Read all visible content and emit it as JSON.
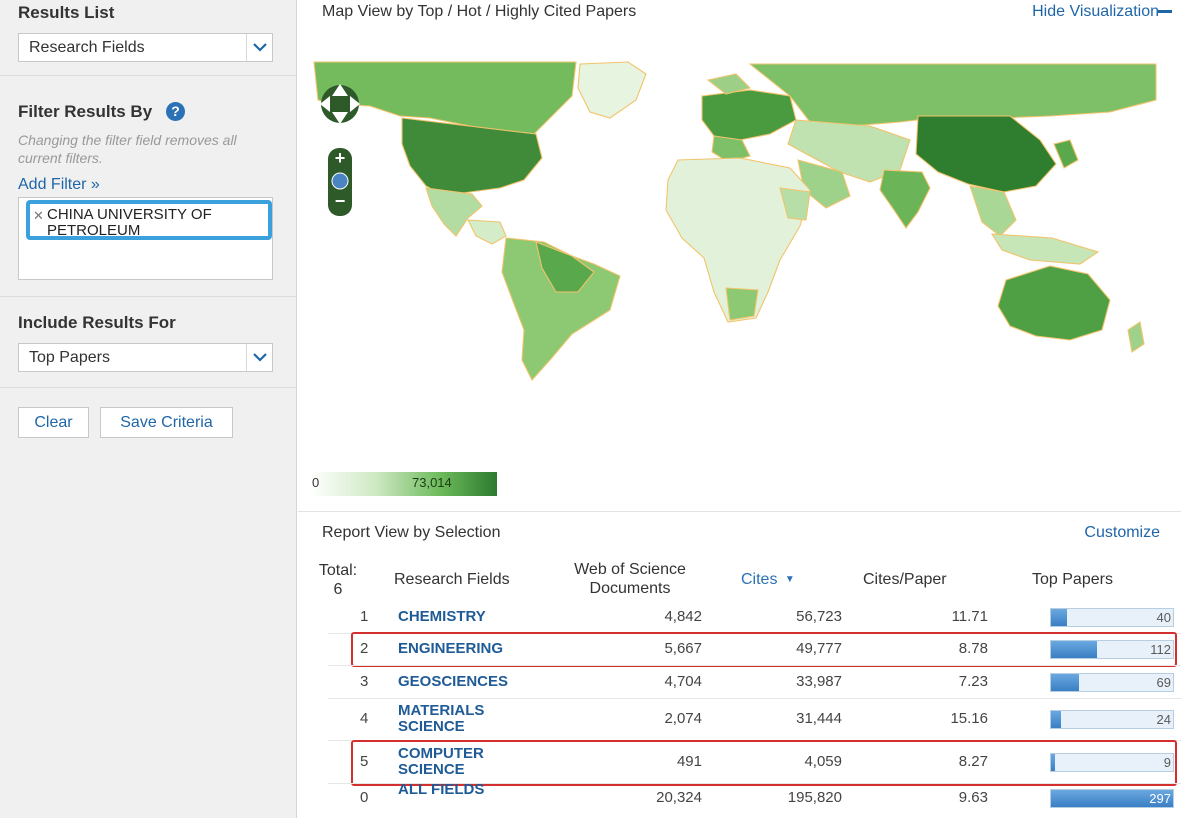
{
  "sidebar": {
    "results_list_title": "Results List",
    "results_list_value": "Research Fields",
    "filter_title": "Filter Results By",
    "help_glyph": "?",
    "filter_hint": "Changing the filter field removes all current filters.",
    "add_filter": "Add Filter »",
    "filter_chip": "CHINA UNIVERSITY OF PETROLEUM",
    "include_title": "Include Results For",
    "include_value": "Top Papers",
    "clear_button": "Clear",
    "save_button": "Save Criteria"
  },
  "map_view": {
    "title": "Map View by Top / Hot / Highly Cited Papers",
    "hide_label": "Hide Visualization",
    "legend_min": "0",
    "legend_max": "73,014"
  },
  "report_view": {
    "title": "Report View by Selection",
    "customize": "Customize",
    "headers": {
      "total_label": "Total:",
      "total_value": "6",
      "field": "Research Fields",
      "docs": "Web of Science Documents",
      "cites": "Cites",
      "cites_per_paper": "Cites/Paper",
      "top_papers": "Top Papers"
    },
    "rows": [
      {
        "rank": "1",
        "field": "CHEMISTRY",
        "docs": "4,842",
        "cites": "56,723",
        "cpp": "11.71",
        "top": "40",
        "top_fraction": 0.1347,
        "highlight": false
      },
      {
        "rank": "2",
        "field": "ENGINEERING",
        "docs": "5,667",
        "cites": "49,777",
        "cpp": "8.78",
        "top": "112",
        "top_fraction": 0.3771,
        "highlight": true
      },
      {
        "rank": "3",
        "field": "GEOSCIENCES",
        "docs": "4,704",
        "cites": "33,987",
        "cpp": "7.23",
        "top": "69",
        "top_fraction": 0.2323,
        "highlight": false
      },
      {
        "rank": "4",
        "field": "MATERIALS SCIENCE",
        "docs": "2,074",
        "cites": "31,444",
        "cpp": "15.16",
        "top": "24",
        "top_fraction": 0.0808,
        "highlight": false
      },
      {
        "rank": "5",
        "field": "COMPUTER SCIENCE",
        "docs": "491",
        "cites": "4,059",
        "cpp": "8.27",
        "top": "9",
        "top_fraction": 0.0303,
        "highlight": true
      },
      {
        "rank": "0",
        "field": "ALL FIELDS",
        "docs": "20,324",
        "cites": "195,820",
        "cpp": "9.63",
        "top": "297",
        "top_fraction": 1.0,
        "highlight": false
      }
    ]
  },
  "colors": {
    "accent": "#1f66a8",
    "highlight_box": "#d32f2f",
    "chip_border": "#3ba1dc",
    "map_dark": "#2c7a30",
    "map_light": "#dcefd3"
  }
}
